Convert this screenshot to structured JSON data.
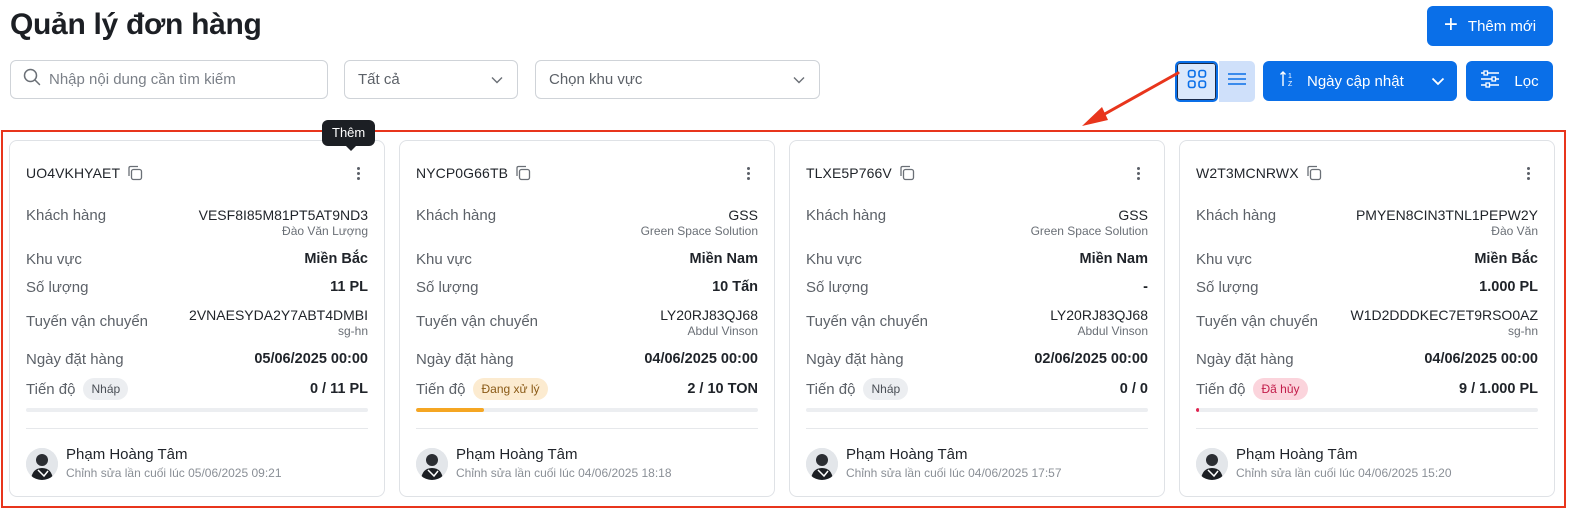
{
  "page": {
    "title": "Quản lý đơn hàng"
  },
  "toolbar": {
    "add_label": "Thêm mới",
    "search_placeholder": "Nhập nội dung cần tìm kiếm",
    "status_select": "Tất cả",
    "area_select": "Chọn khu vực",
    "sort_label": "Ngày cập nhật",
    "filter_label": "Lọc",
    "active_view": "grid"
  },
  "tooltip": {
    "text": "Thêm"
  },
  "colors": {
    "accent": "#0a6fe8",
    "annotation": "#e8351c",
    "processing": "#f5a623",
    "cancelled": "#e0244f"
  },
  "labels": {
    "customer": "Khách hàng",
    "area": "Khu vực",
    "quantity": "Số lượng",
    "route": "Tuyến vận chuyển",
    "order_date": "Ngày đặt hàng",
    "progress": "Tiến độ"
  },
  "orders": [
    {
      "code": "UO4VKHYAET",
      "customer_code": "VESF8I85M81PT5AT9ND3",
      "customer_name": "Đào Văn Lượng",
      "area": "Miền Bắc",
      "quantity": "11 PL",
      "route_code": "2VNAESYDA2Y7ABT4DMBI",
      "route_name": "sg-hn",
      "order_date": "05/06/2025 00:00",
      "status": "Nháp",
      "status_kind": "draft",
      "progress_text": "0 / 11 PL",
      "progress_fraction": 0,
      "progress_color": "#0a6fe8",
      "editor": "Phạm Hoàng Tâm",
      "edited": "Chỉnh sửa lần cuối lúc 05/06/2025 09:21"
    },
    {
      "code": "NYCP0G66TB",
      "customer_code": "GSS",
      "customer_name": "Green Space Solution",
      "area": "Miền Nam",
      "quantity": "10 Tấn",
      "route_code": "LY20RJ83QJ68",
      "route_name": "Abdul Vinson",
      "order_date": "04/06/2025 00:00",
      "status": "Đang xử lý",
      "status_kind": "processing",
      "progress_text": "2 / 10 TON",
      "progress_fraction": 0.2,
      "progress_color": "#f5a623",
      "editor": "Phạm Hoàng Tâm",
      "edited": "Chỉnh sửa lần cuối lúc 04/06/2025 18:18"
    },
    {
      "code": "TLXE5P766V",
      "customer_code": "GSS",
      "customer_name": "Green Space Solution",
      "area": "Miền Nam",
      "quantity": "-",
      "route_code": "LY20RJ83QJ68",
      "route_name": "Abdul Vinson",
      "order_date": "02/06/2025 00:00",
      "status": "Nháp",
      "status_kind": "draft",
      "progress_text": "0 / 0",
      "progress_fraction": 0,
      "progress_color": "#0a6fe8",
      "editor": "Phạm Hoàng Tâm",
      "edited": "Chỉnh sửa lần cuối lúc 04/06/2025 17:57"
    },
    {
      "code": "W2T3MCNRWX",
      "customer_code": "PMYEN8CIN3TNL1PEPW2Y",
      "customer_name": "Đào Văn",
      "area": "Miền Bắc",
      "quantity": "1.000 PL",
      "route_code": "W1D2DDDKEC7ET9RSO0AZ",
      "route_name": "sg-hn",
      "order_date": "04/06/2025 00:00",
      "status": "Đã hủy",
      "status_kind": "cancelled",
      "progress_text": "9 / 1.000 PL",
      "progress_fraction": 0.009,
      "progress_color": "#e0244f",
      "editor": "Phạm Hoàng Tâm",
      "edited": "Chỉnh sửa lần cuối lúc 04/06/2025 15:20"
    }
  ]
}
